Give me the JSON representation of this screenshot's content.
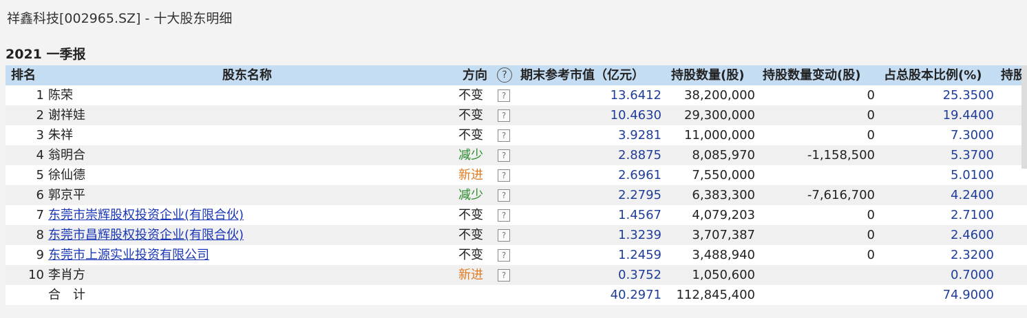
{
  "window_title": "祥鑫科技[002965.SZ] - 十大股东明细",
  "section_title": "2021 一季报",
  "headers": {
    "rank": "排名",
    "name": "股东名称",
    "direction": "方向",
    "direction_help": "?",
    "market_value": "期末参考市值（亿元）",
    "shares": "持股数量(股)",
    "change": "持股数量变动(股)",
    "ratio": "占总股本比例(%)",
    "extra": "持股"
  },
  "help_glyph": "?",
  "rows": [
    {
      "rank": "1",
      "name": "陈荣",
      "link": false,
      "direction": "不变",
      "dir_type": "same",
      "value": "13.6412",
      "shares": "38,200,000",
      "change": "0",
      "ratio": "25.3500"
    },
    {
      "rank": "2",
      "name": "谢祥娃",
      "link": false,
      "direction": "不变",
      "dir_type": "same",
      "value": "10.4630",
      "shares": "29,300,000",
      "change": "0",
      "ratio": "19.4400"
    },
    {
      "rank": "3",
      "name": "朱祥",
      "link": false,
      "direction": "不变",
      "dir_type": "same",
      "value": "3.9281",
      "shares": "11,000,000",
      "change": "0",
      "ratio": "7.3000"
    },
    {
      "rank": "4",
      "name": "翁明合",
      "link": false,
      "direction": "减少",
      "dir_type": "down",
      "value": "2.8875",
      "shares": "8,085,970",
      "change": "-1,158,500",
      "ratio": "5.3700"
    },
    {
      "rank": "5",
      "name": "徐仙德",
      "link": false,
      "direction": "新进",
      "dir_type": "new",
      "value": "2.6961",
      "shares": "7,550,000",
      "change": "",
      "ratio": "5.0100"
    },
    {
      "rank": "6",
      "name": "郭京平",
      "link": false,
      "direction": "减少",
      "dir_type": "down",
      "value": "2.2795",
      "shares": "6,383,300",
      "change": "-7,616,700",
      "ratio": "4.2400"
    },
    {
      "rank": "7",
      "name": "东莞市崇辉股权投资企业(有限合伙)",
      "link": true,
      "direction": "不变",
      "dir_type": "same",
      "value": "1.4567",
      "shares": "4,079,203",
      "change": "0",
      "ratio": "2.7100"
    },
    {
      "rank": "8",
      "name": "东莞市昌辉股权投资企业(有限合伙)",
      "link": true,
      "direction": "不变",
      "dir_type": "same",
      "value": "1.3239",
      "shares": "3,707,387",
      "change": "0",
      "ratio": "2.4600"
    },
    {
      "rank": "9",
      "name": "东莞市上源实业投资有限公司",
      "link": true,
      "direction": "不变",
      "dir_type": "same",
      "value": "1.2459",
      "shares": "3,488,940",
      "change": "0",
      "ratio": "2.3200"
    },
    {
      "rank": "10",
      "name": "李肖方",
      "link": false,
      "direction": "新进",
      "dir_type": "new",
      "value": "0.3752",
      "shares": "1,050,600",
      "change": "",
      "ratio": "0.7000"
    }
  ],
  "total": {
    "label": "合　计",
    "value": "40.2971",
    "shares": "112,845,400",
    "ratio": "74.9000"
  }
}
